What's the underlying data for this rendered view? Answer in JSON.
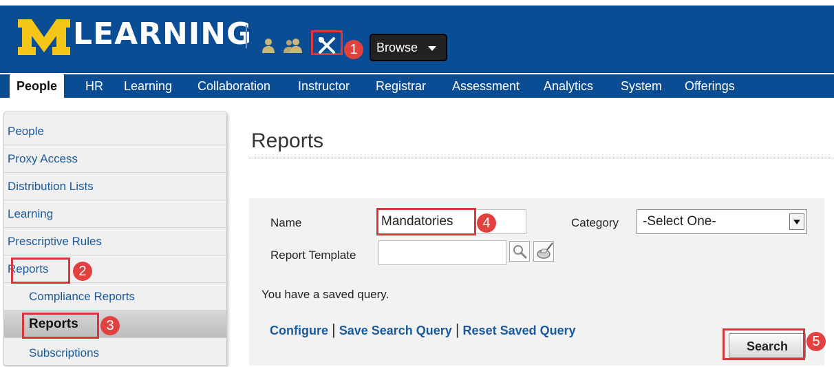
{
  "header": {
    "brand_letter": "M",
    "brand_title": "LEARNING",
    "browse_label": "Browse",
    "logo_color": "#f5c518",
    "bar_color": "#0a4d94"
  },
  "tabs": [
    {
      "label": "People",
      "active": true
    },
    {
      "label": "HR"
    },
    {
      "label": "Learning"
    },
    {
      "label": "Collaboration"
    },
    {
      "label": "Instructor"
    },
    {
      "label": "Registrar"
    },
    {
      "label": "Assessment"
    },
    {
      "label": "Analytics"
    },
    {
      "label": "System"
    },
    {
      "label": "Offerings"
    }
  ],
  "sidebar": {
    "items": [
      {
        "label": "People"
      },
      {
        "label": "Proxy Access"
      },
      {
        "label": "Distribution Lists"
      },
      {
        "label": "Learning"
      },
      {
        "label": "Prescriptive Rules"
      },
      {
        "label": "Reports"
      },
      {
        "label": "Compliance Reports"
      },
      {
        "label": "Reports",
        "selected": true
      },
      {
        "label": "Subscriptions"
      }
    ]
  },
  "main": {
    "title": "Reports",
    "form": {
      "name_label": "Name",
      "name_value": "Mandatories",
      "category_label": "Category",
      "category_value": "-Select One-",
      "template_label": "Report Template",
      "template_value": ""
    },
    "saved_message": "You have a saved query.",
    "links": {
      "configure": "Configure",
      "save_query": "Save Search Query",
      "reset_query": "Reset Saved Query",
      "separator": "|"
    },
    "search_label": "Search"
  },
  "annotations": {
    "step1": "1",
    "step2": "2",
    "step3": "3",
    "step4": "4",
    "step5": "5",
    "highlight_color": "#d9363e"
  },
  "icons": {
    "user": "user-icon",
    "users": "users-icon",
    "tools": "tools-icon",
    "search": "magnifier-icon",
    "clear": "eraser-icon"
  }
}
